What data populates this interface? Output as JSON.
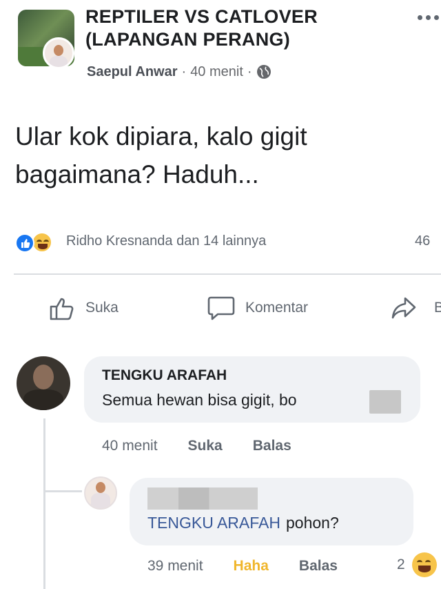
{
  "post": {
    "group_name": "REPTILER VS CATLOVER (LAPANGAN PERANG)",
    "author": "Saepul Anwar",
    "separator": "·",
    "time": "40 menit",
    "text": "Ular kok dipiara, kalo gigit bagaimana? Haduh..."
  },
  "reactions": {
    "summary": "Ridho Kresnanda dan 14 lainnya",
    "count_right": "46"
  },
  "actions": {
    "like": "Suka",
    "comment": "Komentar",
    "share": "B"
  },
  "comments": [
    {
      "name": "TENGKU ARAFAH",
      "text": "Semua hewan bisa gigit, bo",
      "time": "40 menit",
      "like": "Suka",
      "reply": "Balas",
      "replies": [
        {
          "mention": "TENGKU ARAFAH",
          "text": "pohon?",
          "time": "39 menit",
          "reaction_label": "Haha",
          "reply": "Balas",
          "reaction_count": "2"
        }
      ]
    }
  ],
  "colors": {
    "like_blue": "#1877f2",
    "haha_yellow": "#f7c44a",
    "mention_blue": "#385898",
    "bubble_bg": "#f0f2f5",
    "meta_gray": "#606770"
  }
}
